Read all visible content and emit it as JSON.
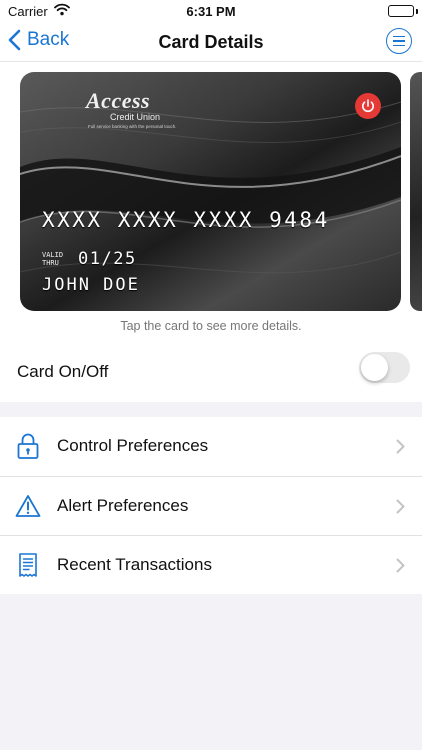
{
  "status_bar": {
    "carrier": "Carrier",
    "time": "6:31 PM"
  },
  "nav": {
    "back_label": "Back",
    "title": "Card Details"
  },
  "card": {
    "logo_name": "Access",
    "logo_sub": "Credit Union",
    "logo_tagline": "Full service banking with the personal touch.",
    "number": "XXXX XXXX XXXX 9484",
    "valid_line1": "VALID",
    "valid_line2": "THRU",
    "expiry": "01/25",
    "holder": "JOHN DOE",
    "hint": "Tap the card to see more details."
  },
  "card_toggle": {
    "label": "Card On/Off",
    "on": false
  },
  "menu": [
    {
      "label": "Control Preferences",
      "icon": "lock-icon"
    },
    {
      "label": "Alert Preferences",
      "icon": "warning-icon"
    },
    {
      "label": "Recent Transactions",
      "icon": "receipt-icon"
    }
  ],
  "colors": {
    "accent": "#1b76d3",
    "power": "#e53935",
    "background": "#f2f2f7"
  }
}
